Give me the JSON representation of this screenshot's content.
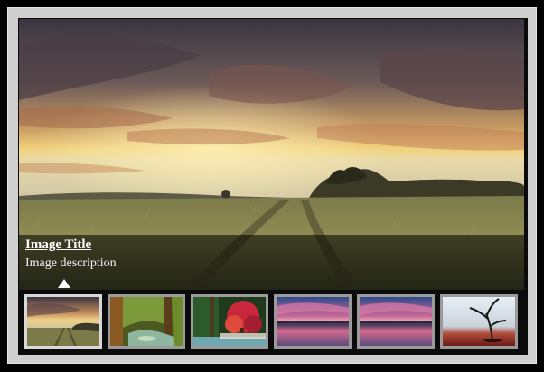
{
  "caption": {
    "title": "Image Title",
    "description": "Image description"
  },
  "main_image": {
    "subject": "sunset-over-grass-field-with-track"
  },
  "thumbnails": [
    {
      "subject": "sunset-field",
      "active": true
    },
    {
      "subject": "forest-stream",
      "active": false
    },
    {
      "subject": "autumn-red-tree",
      "active": false
    },
    {
      "subject": "pink-sunset-over-water",
      "active": false
    },
    {
      "subject": "pink-sunset-over-water",
      "active": false
    },
    {
      "subject": "bare-tree-on-red-ground",
      "active": false
    }
  ],
  "colors": {
    "frame": "#cfcfcf",
    "viewer_bg": "#0b0b0b",
    "thumb_border": "#9a9a9a",
    "thumb_border_active": "#d8d8d8"
  }
}
